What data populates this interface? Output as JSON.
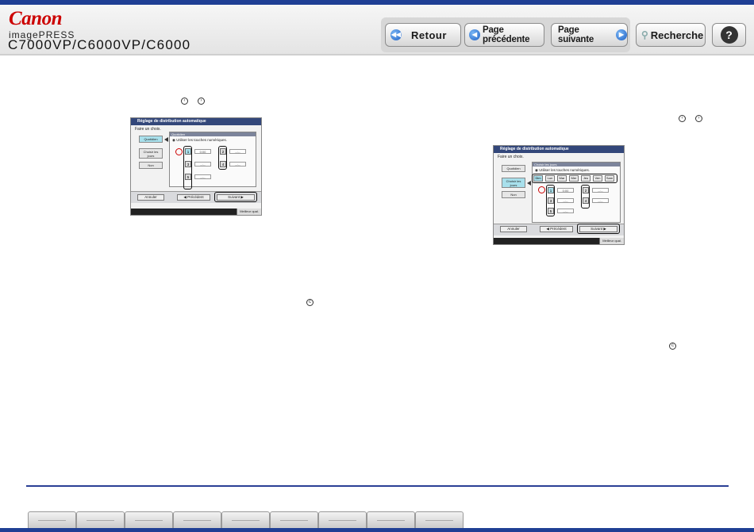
{
  "brand": {
    "logo": "Canon",
    "line": "imagePRESS",
    "model": "C7000VP/C6000VP/C6000"
  },
  "nav": {
    "back_label": "Retour",
    "prev_label": "Page précédente",
    "next_label": "Page suivante",
    "search_label": "Recherche",
    "help_label": "?"
  },
  "colors": {
    "header_blue": "#1f3f94",
    "canon_red": "#cc0000",
    "nav_icon_blue": "#1d5fc4",
    "device_title": "#33477a",
    "device_selected": "#a8e0ec"
  },
  "screen_left": {
    "title": "Réglage de distribution automatique",
    "subtitle": "Faire un choix.",
    "side_items": [
      "Quotidien",
      "Choisir les jours",
      "Non"
    ],
    "panel_title": "Quotidien",
    "radio_label": "Utiliser les touches numériques.",
    "slots": [
      {
        "num": "1",
        "time": "0:00"
      },
      {
        "num": "2",
        "time": "--:--"
      },
      {
        "num": "3",
        "time": "--:--"
      },
      {
        "num": "4",
        "time": "--:--"
      },
      {
        "num": "5",
        "time": "--:--"
      }
    ],
    "buttons": {
      "cancel": "Annuler",
      "prev": "Précédent",
      "next": "Suivant"
    },
    "status": "Meilleur qual."
  },
  "screen_right": {
    "title": "Réglage de distribution automatique",
    "subtitle": "Faire un choix.",
    "side_items": [
      "Quotidien",
      "Choisir les jours",
      "Non"
    ],
    "panel_title": "Choisir les jours",
    "radio_label": "Utiliser les touches numériques.",
    "days": [
      "Dim",
      "Lun",
      "Mar",
      "Mer",
      "Jeu",
      "Ven",
      "Sam"
    ],
    "slots": [
      {
        "num": "1",
        "time": "0:00"
      },
      {
        "num": "2",
        "time": "--:--"
      },
      {
        "num": "3",
        "time": "--:--"
      },
      {
        "num": "4",
        "time": "--:--"
      },
      {
        "num": "5",
        "time": "--:--"
      }
    ],
    "buttons": {
      "cancel": "Annuler",
      "prev": "Précédent",
      "next": "Suivant"
    },
    "status": "Meilleur qual."
  },
  "icons": {
    "prev_next_pair": [
      "arrow-left-icon",
      "arrow-right-icon"
    ],
    "clear_icon": "c"
  }
}
